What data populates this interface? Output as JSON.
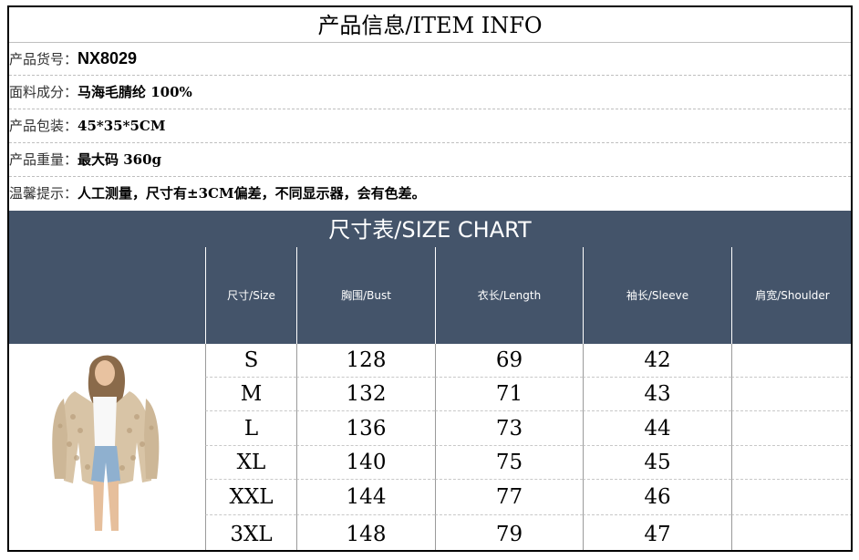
{
  "title": "产品信息/ITEM INFO",
  "info": {
    "item_no_label": "产品货号：",
    "item_no_value": "NX8029",
    "material_label": "面料成分：",
    "material_value": "马海毛腈纶 100%",
    "package_label": "产品包装：",
    "package_value": "45*35*5CM",
    "weight_label": "产品重量：",
    "weight_value": "最大码 360g",
    "note_label": "温馨提示：",
    "note_value": "人工测量，尺寸有±3CM偏差，不同显示器，会有色差。"
  },
  "size_chart": {
    "title": "尺寸表/SIZE CHART",
    "headers": [
      "尺寸/Size",
      "胸围/Bust",
      "衣长/Length",
      "袖长/Sleeve",
      "肩宽/Shoulder"
    ],
    "rows": [
      {
        "size": "S",
        "bust": "128",
        "length": "69",
        "sleeve": "42",
        "shoulder": ""
      },
      {
        "size": "M",
        "bust": "132",
        "length": "71",
        "sleeve": "43",
        "shoulder": ""
      },
      {
        "size": "L",
        "bust": "136",
        "length": "73",
        "sleeve": "44",
        "shoulder": ""
      },
      {
        "size": "XL",
        "bust": "140",
        "length": "75",
        "sleeve": "45",
        "shoulder": ""
      },
      {
        "size": "XXL",
        "bust": "144",
        "length": "77",
        "sleeve": "46",
        "shoulder": ""
      },
      {
        "size": "3XL",
        "bust": "148",
        "length": "79",
        "sleeve": "47",
        "shoulder": ""
      }
    ]
  },
  "colors": {
    "header_bg": "#44546a",
    "header_text": "#ffffff"
  },
  "image": "model-in-beige-knit-cardigan"
}
